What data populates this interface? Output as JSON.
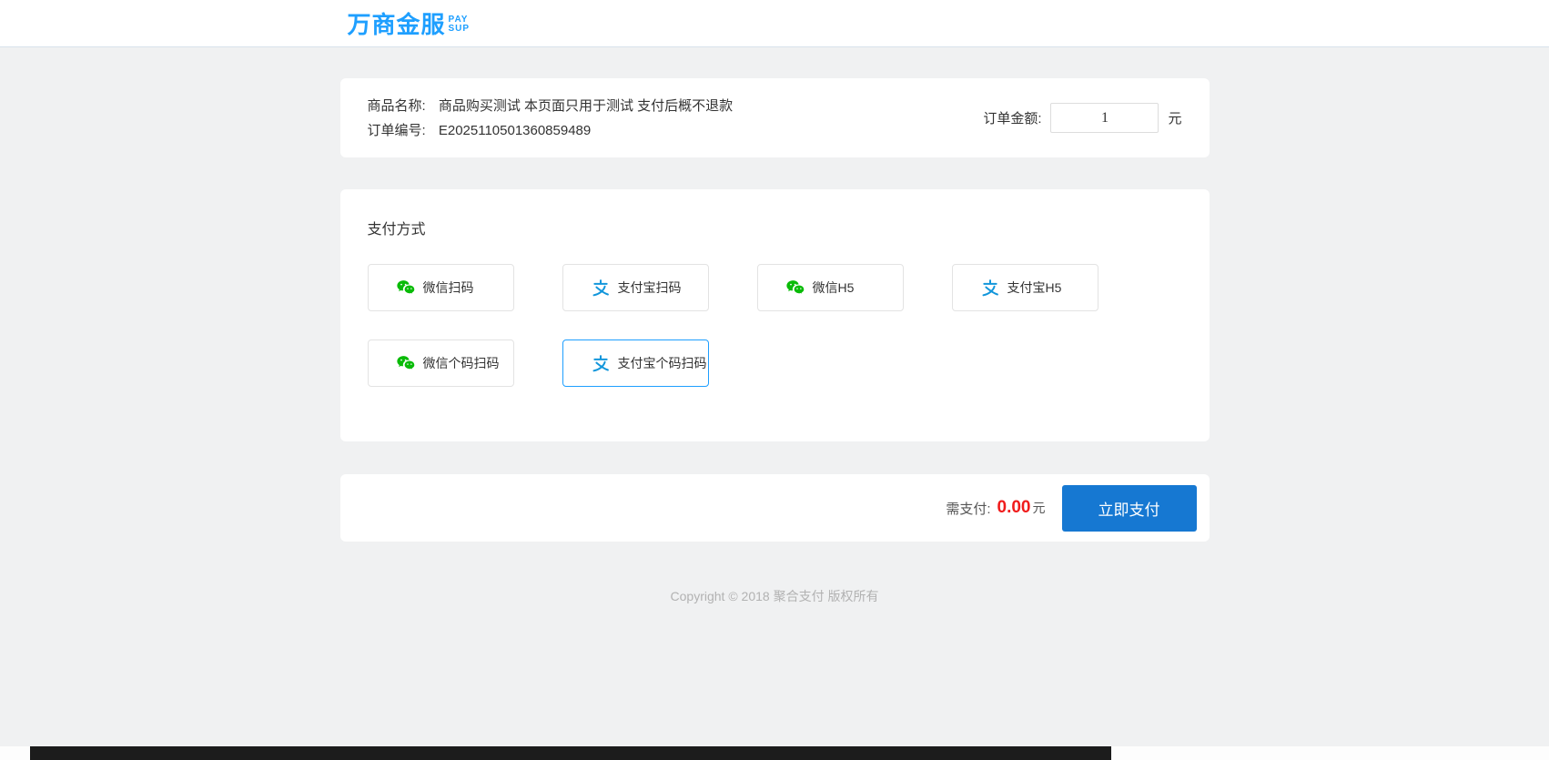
{
  "header": {
    "logo_text": "万商金服",
    "logo_sub_top": "PAY",
    "logo_sub_bottom": "SUP"
  },
  "order": {
    "product_label": "商品名称:",
    "product_value": "商品购买测试 本页面只用于测试 支付后概不退款",
    "order_no_label": "订单编号:",
    "order_no_value": "E2025110501360859489",
    "amount_label": "订单金额:",
    "amount_value": "1",
    "amount_unit": "元"
  },
  "payment": {
    "title": "支付方式",
    "methods": [
      {
        "label": "微信扫码",
        "icon": "wechat-icon",
        "selected": false
      },
      {
        "label": "支付宝扫码",
        "icon": "alipay-icon",
        "selected": false
      },
      {
        "label": "微信H5",
        "icon": "wechat-icon",
        "selected": false
      },
      {
        "label": "支付宝H5",
        "icon": "alipay-icon",
        "selected": false
      },
      {
        "label": "微信个码扫码",
        "icon": "wechat-icon",
        "selected": false
      },
      {
        "label": "支付宝个码扫码",
        "icon": "alipay-icon",
        "selected": true
      }
    ]
  },
  "paybar": {
    "due_label": "需支付:",
    "due_amount": "0.00",
    "due_unit": "元",
    "pay_button": "立即支付"
  },
  "footer": {
    "copyright": "Copyright © 2018 聚合支付 版权所有"
  },
  "colors": {
    "accent_blue": "#1e9fff",
    "button_blue": "#1678d2",
    "wechat_green": "#09bb07",
    "alipay_blue": "#1296db",
    "price_red": "#f01c1c",
    "page_background": "#f0f1f2"
  }
}
